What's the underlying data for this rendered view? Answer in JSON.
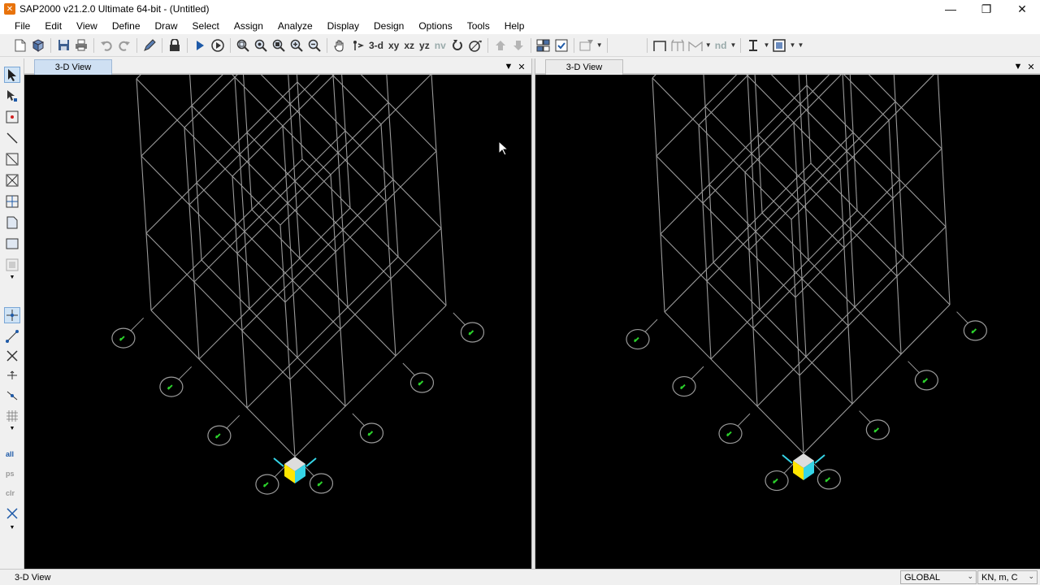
{
  "window": {
    "title": "SAP2000 v21.2.0 Ultimate 64-bit - (Untitled)",
    "controls": {
      "minimize": "—",
      "restore": "❐",
      "close": "✕"
    }
  },
  "menu": {
    "items": [
      "File",
      "Edit",
      "View",
      "Define",
      "Draw",
      "Select",
      "Assign",
      "Analyze",
      "Display",
      "Design",
      "Options",
      "Tools",
      "Help"
    ]
  },
  "toolbar": {
    "view_3d": "3-d",
    "view_xy": "xy",
    "view_xz": "xz",
    "view_yz": "yz",
    "view_nv": "nv",
    "nd_label": "nd"
  },
  "panels": {
    "left": {
      "tab_label": "3-D View",
      "dropdown_glyph": "▼",
      "close_glyph": "✕"
    },
    "right": {
      "tab_label": "3-D View",
      "dropdown_glyph": "▼",
      "close_glyph": "✕"
    }
  },
  "statusbar": {
    "view_name": "3-D View",
    "coord_system": "GLOBAL",
    "units": "KN, m, C"
  },
  "colors": {
    "viewport_bg": "#000000",
    "grid_lines": "#9a9a9a",
    "grid_markers": "#2bd12b",
    "axis_cube_top": "#dddddd",
    "axis_cube_left": "#ffe600",
    "axis_cube_right": "#35d4e6",
    "active_tab": "#cfe0f3"
  }
}
